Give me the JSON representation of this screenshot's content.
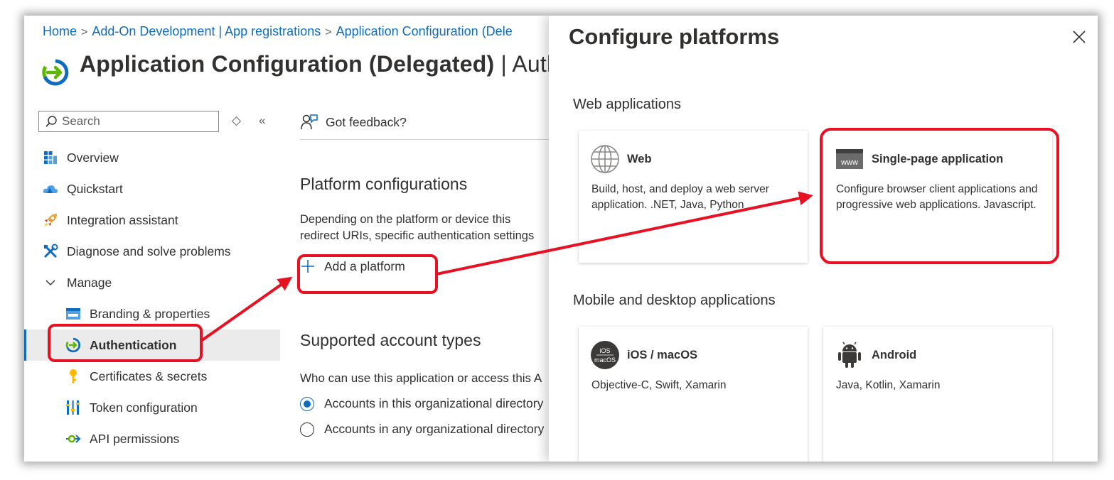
{
  "breadcrumb": {
    "home": "Home",
    "app_registrations": "Add-On Development | App registrations",
    "current": "Application Configuration (Dele"
  },
  "page": {
    "title": "Application Configuration (Delegated)",
    "title_suffix": "| Auth"
  },
  "search": {
    "placeholder": "Search"
  },
  "sidebar": {
    "items": [
      {
        "label": "Overview",
        "icon": "overview-icon"
      },
      {
        "label": "Quickstart",
        "icon": "quickstart-icon"
      },
      {
        "label": "Integration assistant",
        "icon": "rocket-icon"
      },
      {
        "label": "Diagnose and solve problems",
        "icon": "wrench-icon"
      },
      {
        "label": "Manage",
        "icon": "chevron-down-icon"
      },
      {
        "label": "Branding & properties",
        "icon": "branding-icon"
      },
      {
        "label": "Authentication",
        "icon": "authentication-icon",
        "active": true
      },
      {
        "label": "Certificates & secrets",
        "icon": "key-icon"
      },
      {
        "label": "Token configuration",
        "icon": "token-icon"
      },
      {
        "label": "API permissions",
        "icon": "api-permissions-icon"
      }
    ]
  },
  "main": {
    "feedback": "Got feedback?",
    "platform_heading": "Platform configurations",
    "platform_desc_line1": "Depending on the platform or device this",
    "platform_desc_line2": "redirect URIs, specific authentication settings",
    "add_platform": "Add a platform",
    "account_heading": "Supported account types",
    "account_desc": "Who can use this application or access this A",
    "radio_options": [
      {
        "label": "Accounts in this organizational directory",
        "selected": true
      },
      {
        "label": "Accounts in any organizational directory",
        "selected": false
      }
    ]
  },
  "panel": {
    "title": "Configure platforms",
    "web_group": "Web applications",
    "mobile_group": "Mobile and desktop applications",
    "cards": {
      "web": {
        "title": "Web",
        "desc": "Build, host, and deploy a web server application. .NET, Java, Python",
        "icon": "globe-icon"
      },
      "spa": {
        "title": "Single-page application",
        "desc": "Configure browser client applications and progressive web applications. Javascript.",
        "icon": "www-icon",
        "icon_text": "www"
      },
      "ios": {
        "title": "iOS / macOS",
        "desc": "Objective-C, Swift, Xamarin",
        "icon": "ios-macos-icon",
        "icon_text_top": "iOS",
        "icon_text_bottom": "macOS"
      },
      "android": {
        "title": "Android",
        "desc": "Java, Kotlin, Xamarin",
        "icon": "android-icon"
      }
    }
  },
  "colors": {
    "link": "#0f6cbd",
    "annotation_red": "#e81123",
    "active_bg": "#ebebeb"
  }
}
